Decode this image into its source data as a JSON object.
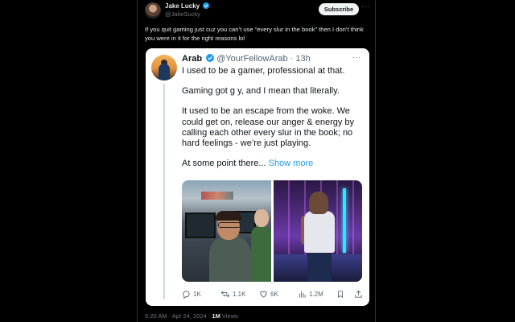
{
  "outer_post": {
    "author_name": "Jake Lucky",
    "author_handle": "@JakeSucky",
    "subscribe_label": "Subscribe",
    "text": "If you quit gaming just cuz you can’t use “every slur in the book” then I don’t think you were in it for the right reasons lol",
    "timestamp": "5:20 AM · Apr 24, 2024",
    "views_count": "1M",
    "views_label": "Views",
    "verified_color": "#1d9bf0"
  },
  "quoted_post": {
    "author_name": "Arab",
    "author_handle": "@YourFellowArab",
    "time": "· 13h",
    "paragraphs": [
      "I used to be a gamer, professional at that.",
      "Gaming got g  y, and I mean that literally.",
      "It used to be an escape from the woke. We could get on, release our anger & energy by calling each other every slur in the book; no hard feelings - we’re just playing.",
      "At some point there..."
    ],
    "show_more_label": "Show more",
    "actions": {
      "replies": "1K",
      "reposts": "1.1K",
      "likes": "6K",
      "views": "1.2M"
    }
  }
}
